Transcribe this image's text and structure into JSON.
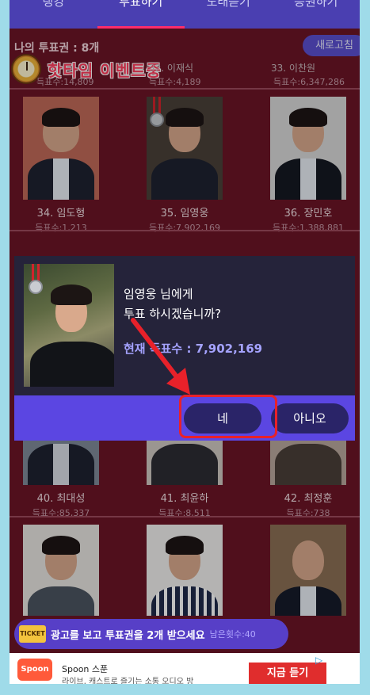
{
  "tabs": [
    "랭킹",
    "투표하기",
    "노래듣기",
    "응원하기"
  ],
  "header": {
    "vote_count": "나의 투표권 : 8개",
    "refresh": "새로고침",
    "event": "핫타임 이벤트중"
  },
  "top_partial": [
    {
      "name": "",
      "count": "득표수:14,809"
    },
    {
      "name": "32. 이재식",
      "count": "득표수:4,189"
    },
    {
      "name": "33. 이찬원",
      "count": "득표수:6,347,286"
    }
  ],
  "row1": [
    {
      "name": "34. 임도형",
      "count": "득표수:1,213"
    },
    {
      "name": "35. 임영웅",
      "count": "득표수:7,902,169"
    },
    {
      "name": "36. 장민호",
      "count": "득표수:1,388,881"
    }
  ],
  "row3": [
    {
      "name": "40. 최대성",
      "count": "득표수:85,337"
    },
    {
      "name": "41. 최윤하",
      "count": "득표수:8,511"
    },
    {
      "name": "42. 최정훈",
      "count": "득표수:738"
    }
  ],
  "dialog": {
    "line1": "임영웅 님에게",
    "line2": "투표 하시겠습니까?",
    "count": "현재 득표수 : 7,902,169",
    "yes": "네",
    "no": "아니오"
  },
  "ad_pill": {
    "ticket": "TICKET",
    "text": "광고를 보고 투표권을 2개 받으세요",
    "remain": "남은횟수:40"
  },
  "banner": {
    "logo": "Spoon",
    "title": "Spoon 스푼",
    "sub": "라이브, 캐스트로 즐기는 소통 오디오 방",
    "button": "지금 듣기"
  },
  "colors": {
    "background": "#6b1426",
    "dialog": "#25233a",
    "accent": "#5b46e2",
    "highlight": "#e8212a"
  }
}
